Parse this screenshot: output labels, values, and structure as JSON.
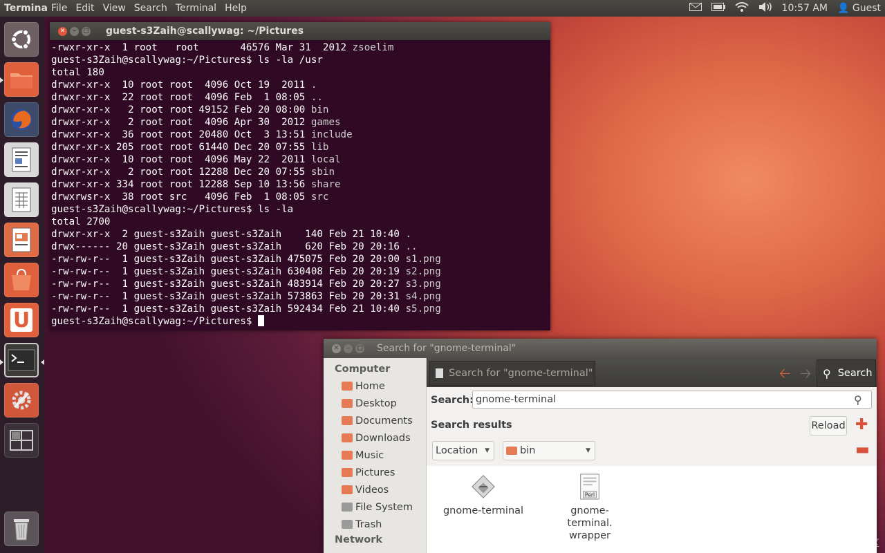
{
  "top_panel": {
    "app_title": "Terminal",
    "menus": [
      "File",
      "Edit",
      "View",
      "Search",
      "Terminal",
      "Help"
    ],
    "clock": "10:57 AM",
    "user": "Guest"
  },
  "launcher": {
    "items": [
      "ubuntu-dash",
      "home-folder",
      "firefox",
      "libreoffice-writer",
      "libreoffice-calc",
      "libreoffice-impress",
      "ubuntu-software-center",
      "ubuntu-one",
      "terminal",
      "system-settings",
      "workspace-switcher",
      "trash"
    ]
  },
  "terminal": {
    "title": "guest-s3Zaih@scallywag: ~/Pictures",
    "lines": [
      {
        "text": "-rwxr-xr-x  1 root   root       46576 Mar 31  2012 ",
        "file": "zsoelim"
      },
      {
        "text": "guest-s3Zaih@scallywag:~/Pictures$ ls -la /usr",
        "file": ""
      },
      {
        "text": "total 180",
        "file": ""
      },
      {
        "text": "drwxr-xr-x  10 root root  4096 Oct 19  2011 ",
        "file": "."
      },
      {
        "text": "drwxr-xr-x  22 root root  4096 Feb  1 08:05 ",
        "file": ".."
      },
      {
        "text": "drwxr-xr-x   2 root root 49152 Feb 20 08:00 ",
        "file": "bin"
      },
      {
        "text": "drwxr-xr-x   2 root root  4096 Apr 30  2012 ",
        "file": "games"
      },
      {
        "text": "drwxr-xr-x  36 root root 20480 Oct  3 13:51 ",
        "file": "include"
      },
      {
        "text": "drwxr-xr-x 205 root root 61440 Dec 20 07:55 ",
        "file": "lib"
      },
      {
        "text": "drwxr-xr-x  10 root root  4096 May 22  2011 ",
        "file": "local"
      },
      {
        "text": "drwxr-xr-x   2 root root 12288 Dec 20 07:55 ",
        "file": "sbin"
      },
      {
        "text": "drwxr-xr-x 334 root root 12288 Sep 10 13:56 ",
        "file": "share"
      },
      {
        "text": "drwxrwsr-x  38 root src   4096 Feb  1 08:05 ",
        "file": "src"
      },
      {
        "text": "guest-s3Zaih@scallywag:~/Pictures$ ls -la",
        "file": ""
      },
      {
        "text": "total 2700",
        "file": ""
      },
      {
        "text": "drwxr-xr-x  2 guest-s3Zaih guest-s3Zaih    140 Feb 21 10:40 ",
        "file": "."
      },
      {
        "text": "drwx------ 20 guest-s3Zaih guest-s3Zaih    620 Feb 20 20:16 ",
        "file": ".."
      },
      {
        "text": "-rw-rw-r--  1 guest-s3Zaih guest-s3Zaih 475075 Feb 20 20:00 ",
        "file": "s1.png"
      },
      {
        "text": "-rw-rw-r--  1 guest-s3Zaih guest-s3Zaih 630408 Feb 20 20:19 ",
        "file": "s2.png"
      },
      {
        "text": "-rw-rw-r--  1 guest-s3Zaih guest-s3Zaih 483914 Feb 20 20:27 ",
        "file": "s3.png"
      },
      {
        "text": "-rw-rw-r--  1 guest-s3Zaih guest-s3Zaih 573863 Feb 20 20:31 ",
        "file": "s4.png"
      },
      {
        "text": "-rw-rw-r--  1 guest-s3Zaih guest-s3Zaih 592434 Feb 21 10:40 ",
        "file": "s5.png"
      }
    ],
    "prompt": "guest-s3Zaih@scallywag:~/Pictures$"
  },
  "search_window": {
    "title": "Search for \"gnome-terminal\"",
    "tab_label": "Search for \"gnome-terminal\"",
    "search_button": "Search",
    "search_label": "Search:",
    "search_value": "gnome-terminal",
    "results_label": "Search results",
    "reload_label": "Reload",
    "location_combo": "Location",
    "bin_combo": "bin",
    "sidebar": {
      "heading": "Computer",
      "items": [
        "Home",
        "Desktop",
        "Documents",
        "Downloads",
        "Music",
        "Pictures",
        "Videos",
        "File System",
        "Trash"
      ],
      "next_heading": "Network"
    },
    "results": [
      {
        "name": "gnome-terminal",
        "icon": "executable-icon"
      },
      {
        "name": "gnome-terminal.\nwrapper",
        "icon": "perl-script-icon",
        "badge": "Perl"
      }
    ]
  },
  "watermark": "@稀土掘金技术社区",
  "colors": {
    "terminal_bg": "#300a24",
    "accent_orange": "#e0573b"
  }
}
